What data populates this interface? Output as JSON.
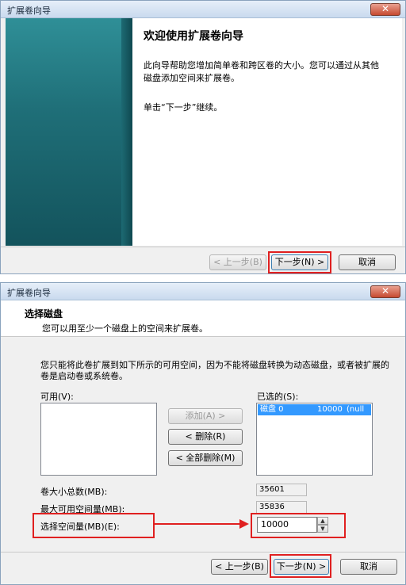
{
  "wizard1": {
    "title": "扩展卷向导",
    "close": "✕",
    "heading": "欢迎使用扩展卷向导",
    "para1": "此向导帮助您增加简单卷和跨区卷的大小。您可以通过从其他磁盘添加空间来扩展卷。",
    "para2": "单击“下一步”继续。",
    "back_label": "< 上一步(B)",
    "next_label": "下一步(N) >",
    "cancel_label": "取消"
  },
  "wizard2": {
    "title": "扩展卷向导",
    "close": "✕",
    "heading": "选择磁盘",
    "subheading": "您可以用至少一个磁盘上的空间来扩展卷。",
    "note": "您只能将此卷扩展到如下所示的可用空间，因为不能将磁盘转换为动态磁盘，或者被扩展的卷是启动卷或系统卷。",
    "available_label": "可用(V):",
    "selected_label": "已选的(S):",
    "selected_items": [
      {
        "disk": "磁盘 0",
        "size": "10000",
        "extra": "(null"
      }
    ],
    "add_label": "添加(A) >",
    "remove_label": "< 删除(R)",
    "remove_all_label": "< 全部删除(M)",
    "total_size_label": "卷大小总数(MB):",
    "total_size_value": "35601",
    "max_space_label": "最大可用空间量(MB):",
    "max_space_value": "35836",
    "select_space_label": "选择空间量(MB)(E):",
    "select_space_value": "10000",
    "back_label": "< 上一步(B)",
    "next_label": "下一步(N) >",
    "cancel_label": "取消"
  },
  "colors": {
    "highlight": "#e02020",
    "banner_teal": "#1f6f78",
    "selection": "#3399ff"
  }
}
